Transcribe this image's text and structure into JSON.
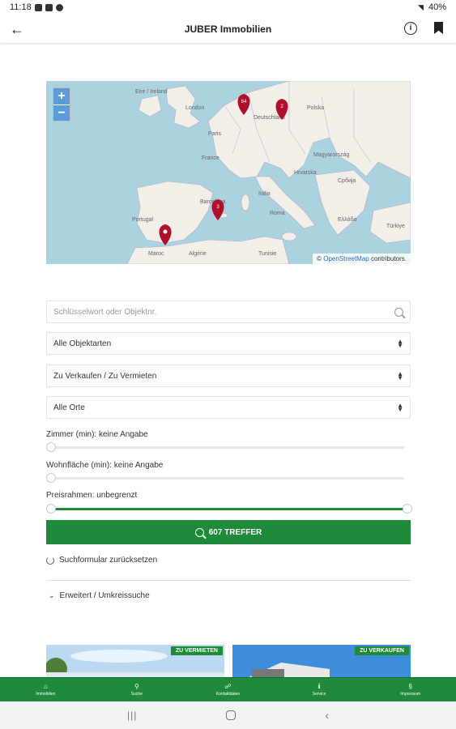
{
  "status_bar": {
    "time": "11:18",
    "battery": "40%"
  },
  "app_bar": {
    "title": "JUBER Immobilien"
  },
  "map": {
    "zoom_in": "+",
    "zoom_out": "−",
    "attribution_prefix": "©",
    "attribution_link": "OpenStreetMap",
    "attribution_suffix": "contributors.",
    "pins": [
      {
        "count": "64"
      },
      {
        "count": "2"
      },
      {
        "count": "3"
      },
      {
        "count": ""
      }
    ],
    "labels": [
      "Eire / Ireland",
      "London",
      "Paris",
      "France",
      "Portugal",
      "Deutschland",
      "Polska",
      "Barcelona",
      "Roma",
      "Magyarország",
      "Hrvatska",
      "Србија",
      "Italia",
      "Tunisie",
      "Algérie",
      "Maroc",
      "Ελλάδα",
      "Türkiye"
    ]
  },
  "search": {
    "placeholder": "Schlüsselwort oder Objektnr."
  },
  "selects": {
    "type": "Alle Objektarten",
    "mode": "Zu Verkaufen / Zu Vermieten",
    "location": "Alle Orte"
  },
  "sliders": {
    "rooms_label": "Zimmer (min): keine Angabe",
    "rooms_value": 0,
    "area_label": "Wohnfläche (min): keine Angabe",
    "area_value": 0,
    "price_label": "Preisrahmen: unbegrenzt",
    "price_range": [
      0,
      1
    ]
  },
  "results_button": "607 TREFFER",
  "reset_label": "Suchformular zurücksetzen",
  "advanced_label": "Erweitert / Umkreissuche",
  "cards": [
    {
      "badge": "ZU VERMIETEN"
    },
    {
      "badge": "ZU VERKAUFEN"
    }
  ],
  "bottom_nav": [
    {
      "label": "Immobilien",
      "icon": "home-icon"
    },
    {
      "label": "Suche",
      "icon": "search-icon"
    },
    {
      "label": "Kontaktdaten",
      "icon": "contacts-icon"
    },
    {
      "label": "Service",
      "icon": "info-icon"
    },
    {
      "label": "Impressum",
      "icon": "imprint-icon"
    }
  ],
  "colors": {
    "accent": "#1e8a3a",
    "map_water": "#aad3df",
    "map_land": "#f2efe9",
    "pin": "#b0102a"
  }
}
